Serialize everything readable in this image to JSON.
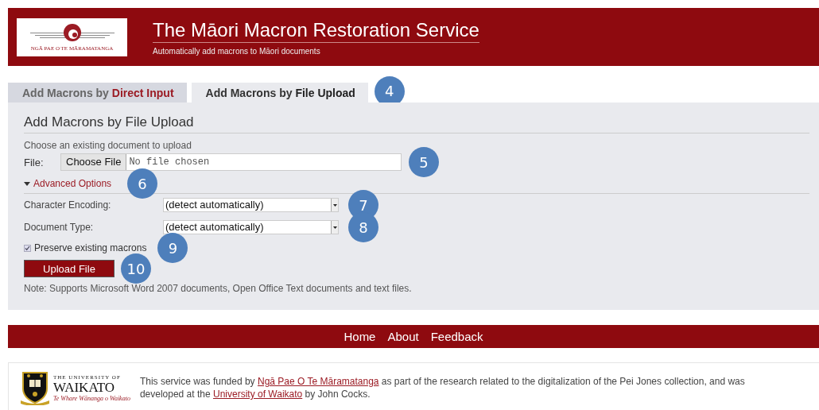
{
  "header": {
    "logo_text": "NGĀ PAE O TE MĀRAMATANGA",
    "title": "The Māori Macron Restoration Service",
    "subtitle": "Automatically add macrons to Māori documents"
  },
  "tabs": [
    {
      "label_start": "Add Macrons by ",
      "label_end": "Direct Input",
      "selected": false
    },
    {
      "label_start": "Add Macrons by ",
      "label_end": "File Upload",
      "selected": true
    }
  ],
  "tabs_callout": "4",
  "form": {
    "heading": "Add Macrons by File Upload",
    "hint": "Choose an existing document to upload",
    "file_label": "File:",
    "file_button": "Choose File",
    "file_status": "No file chosen",
    "file_callout": "5",
    "advanced": {
      "label": "Advanced Options",
      "expanded": true,
      "callout": "6"
    },
    "selects": [
      {
        "label": "Character Encoding:",
        "value": "(detect automatically)",
        "callout": "7"
      },
      {
        "label": "Document Type:",
        "value": "(detect automatically)",
        "callout": "8"
      }
    ],
    "checkbox": {
      "label": "Preserve existing macrons",
      "checked": true,
      "callout": "9"
    },
    "submit": {
      "label": "Upload File",
      "callout": "10"
    },
    "note": "Note: Supports Microsoft Word 2007 documents, Open Office Text documents and text files."
  },
  "nav": [
    "Home",
    "About",
    "Feedback"
  ],
  "footer": {
    "logo_small": "THE UNIVERSITY OF",
    "logo_big": "WAIKATO",
    "logo_motto": "Te Whare Wānanga o Waikato",
    "text_1": "This service was funded by ",
    "link_1": "Ngā Pae O Te Māramatanga",
    "text_2": " as part of the research related to the digitalization of the Pei Jones collection, and was developed at the ",
    "link_2": "University of Waikato",
    "text_3": " by John Cocks."
  }
}
